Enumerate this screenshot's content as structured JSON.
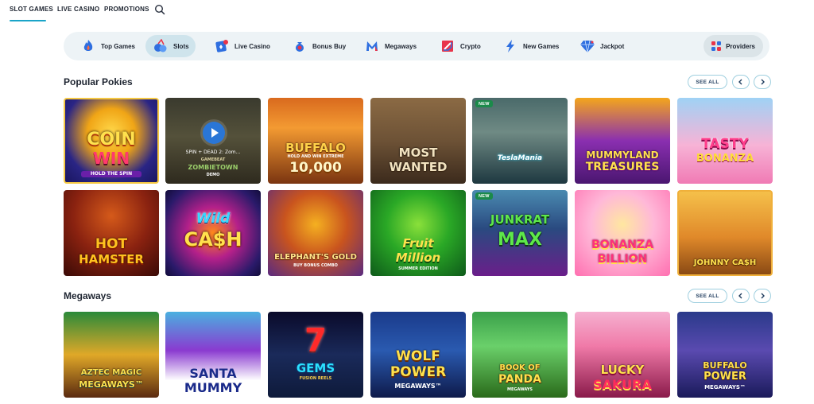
{
  "topnav": {
    "items": [
      "SLOT GAMES",
      "LIVE CASINO",
      "PROMOTIONS"
    ],
    "search_icon": "search-icon"
  },
  "categories": [
    {
      "label": "Top Games",
      "icon": "flame-icon"
    },
    {
      "label": "Slots",
      "icon": "slot-cherries-icon"
    },
    {
      "label": "Live Casino",
      "icon": "live-cards-icon"
    },
    {
      "label": "Bonus Buy",
      "icon": "money-bag-icon"
    },
    {
      "label": "Megaways",
      "icon": "megaways-m-icon"
    },
    {
      "label": "Crypto",
      "icon": "crypto-icon"
    },
    {
      "label": "New Games",
      "icon": "lightning-icon"
    },
    {
      "label": "Jackpot",
      "icon": "diamond-icon"
    }
  ],
  "providers_label": "Providers",
  "sections": [
    {
      "title": "Popular Pokies",
      "see_all": "SEE ALL"
    },
    {
      "title": "Megaways",
      "see_all": "SEE ALL"
    }
  ],
  "tiles": {
    "coin_win": {
      "line1": "COIN",
      "line2": "WIN",
      "sub": "HOLD THE SPIN"
    },
    "spin_dead": {
      "line1": "SPIN + DEAD 2: Zom...",
      "line2": "GAMEBEAT",
      "line3": "ZOMBIETOWN",
      "sub": "DEMO"
    },
    "buffalo": {
      "line1": "BUFFALO",
      "sub": "HOLD AND WIN EXTREME",
      "line2": "10,000"
    },
    "most_wanted": {
      "line1": "MOST",
      "line2": "WANTED"
    },
    "teslamania": {
      "badge": "NEW",
      "line1": "TeslaMania"
    },
    "mummyland": {
      "line1": "MUMMYLAND",
      "line2": "TREASURES"
    },
    "tasty": {
      "line1": "TASTY",
      "line2": "BONANZA"
    },
    "hot_hamster": {
      "line1": "HOT",
      "line2": "HAMSTER"
    },
    "wild_cash": {
      "line1": "Wild",
      "line2": "CA$H"
    },
    "elephant": {
      "line1": "ELEPHANT'S GOLD",
      "sub": "BUY BONUS COMBO"
    },
    "fruit_million": {
      "line1": "Fruit",
      "line2": "Million",
      "sub": "SUMMER EDITION"
    },
    "junkrat": {
      "badge": "NEW",
      "line1": "JUNKRAT",
      "line2": "MAX"
    },
    "bonanza_billion": {
      "line1": "BONANZA",
      "line2": "BILLION"
    },
    "johnny_cash": {
      "line1": "JOHNNY CA$H"
    },
    "aztec": {
      "line1": "AZTEC MAGIC",
      "line2": "MEGAWAYS™"
    },
    "santa_mummy": {
      "line1": "SANTA",
      "line2": "MUMMY"
    },
    "gems": {
      "line1": "7",
      "line2": "GEMS",
      "sub": "FUSION REELS"
    },
    "wolf_power": {
      "line1": "WOLF",
      "line2": "POWER",
      "sub": "MEGAWAYS™"
    },
    "book_panda": {
      "line1": "BOOK OF",
      "line2": "PANDA",
      "sub": "MEGAWAYS"
    },
    "lucky_sakura": {
      "line1": "LUCKY",
      "line2": "SAKURA"
    },
    "buffalo_power": {
      "line1": "BUFFALO",
      "line2": "POWER",
      "sub": "MEGAWAYS™"
    }
  },
  "colors": {
    "accent": "#1aa4c8",
    "category_bg": "#edf3f6",
    "active_bg": "#cfe4ec"
  }
}
